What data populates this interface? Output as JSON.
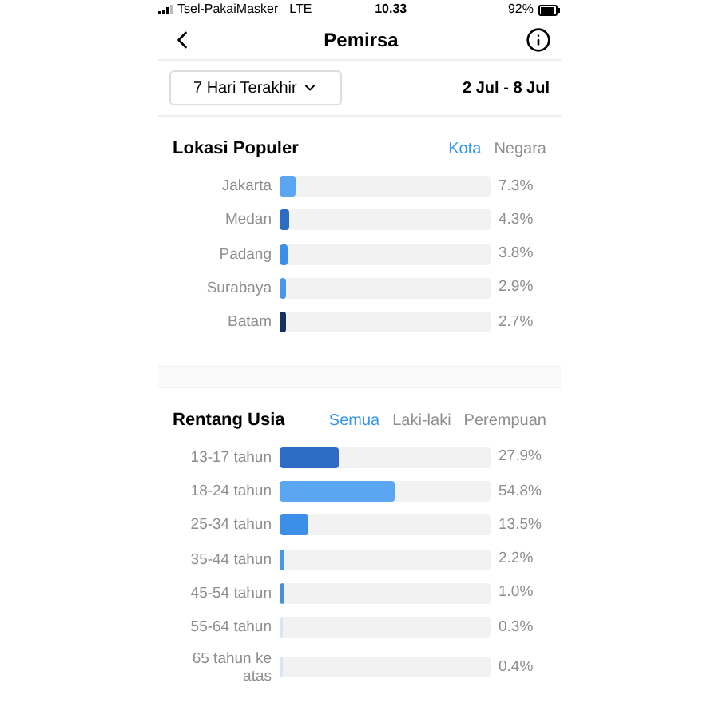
{
  "status_bar": {
    "carrier": "Tsel-PakaiMasker",
    "network": "LTE",
    "time": "10.33",
    "battery": "92%"
  },
  "header": {
    "title": "Pemirsa"
  },
  "period": {
    "dropdown": "7 Hari Terakhir",
    "range": "2 Jul - 8 Jul"
  },
  "sections": [
    {
      "title": "Lokasi Populer",
      "tabs": [
        {
          "label": "Kota",
          "selected": true
        },
        {
          "label": "Negara",
          "selected": false
        }
      ],
      "rows": [
        {
          "label": "Jakarta",
          "level": 0.073,
          "color": "#5aa6f2",
          "reading": "7.3%"
        },
        {
          "label": "Medan",
          "level": 0.043,
          "color": "#2c6cc4",
          "reading": "4.3%"
        },
        {
          "label": "Padang",
          "level": 0.038,
          "color": "#3d8ee6",
          "reading": "3.8%"
        },
        {
          "label": "Surabaya",
          "level": 0.029,
          "color": "#4a96e8",
          "reading": "2.9%"
        },
        {
          "label": "Batam",
          "level": 0.027,
          "color": "#14325e",
          "reading": "2.7%"
        }
      ]
    },
    {
      "title": "Rentang Usia",
      "tabs": [
        {
          "label": "Semua",
          "selected": true
        },
        {
          "label": "Laki-laki",
          "selected": false
        },
        {
          "label": "Perempuan",
          "selected": false
        }
      ],
      "rows": [
        {
          "label": "13-17 tahun",
          "level": 0.279,
          "color": "#2c6cc4",
          "reading": "27.9%"
        },
        {
          "label": "18-24 tahun",
          "level": 0.548,
          "color": "#5aa6f2",
          "reading": "54.8%"
        },
        {
          "label": "25-34 tahun",
          "level": 0.135,
          "color": "#3d8ee6",
          "reading": "13.5%"
        },
        {
          "label": "35-44 tahun",
          "level": 0.022,
          "color": "#4a96e8",
          "reading": "2.2%"
        },
        {
          "label": "45-54 tahun",
          "level": 0.01,
          "color": "#4a90d9",
          "reading": "1.0%"
        },
        {
          "label": "55-64 tahun",
          "level": 0.003,
          "color": "#d6e6f7",
          "reading": "0.3%"
        },
        {
          "label": "65 tahun ke atas",
          "level": 0.004,
          "color": "#d6e6f7",
          "reading": "0.4%"
        }
      ]
    }
  ]
}
